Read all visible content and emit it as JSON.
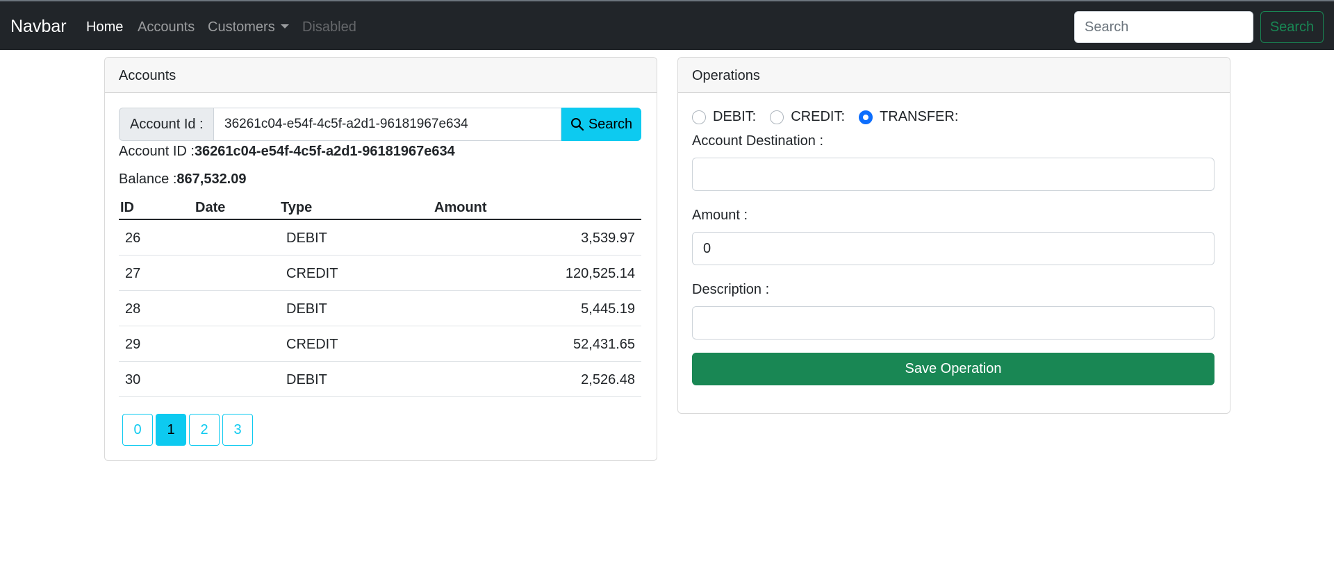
{
  "navbar": {
    "brand": "Navbar",
    "links": [
      {
        "label": "Home"
      },
      {
        "label": "Accounts"
      },
      {
        "label": "Customers"
      },
      {
        "label": "Disabled"
      }
    ],
    "search_placeholder": "Search",
    "search_button": "Search"
  },
  "accounts": {
    "title": "Accounts",
    "input_label": "Account Id :",
    "input_value": "36261c04-e54f-4c5f-a2d1-96181967e634",
    "search_button": "Search",
    "account_id_label": "Account ID :",
    "account_id_value": "36261c04-e54f-4c5f-a2d1-96181967e634",
    "balance_label": "Balance :",
    "balance_value": "867,532.09",
    "table": {
      "headers": [
        "ID",
        "Date",
        "Type",
        "Amount"
      ],
      "rows": [
        {
          "id": "26",
          "date": "",
          "type": "DEBIT",
          "amount": "3,539.97"
        },
        {
          "id": "27",
          "date": "",
          "type": "CREDIT",
          "amount": "120,525.14"
        },
        {
          "id": "28",
          "date": "",
          "type": "DEBIT",
          "amount": "5,445.19"
        },
        {
          "id": "29",
          "date": "",
          "type": "CREDIT",
          "amount": "52,431.65"
        },
        {
          "id": "30",
          "date": "",
          "type": "DEBIT",
          "amount": "2,526.48"
        }
      ]
    },
    "pages": [
      "0",
      "1",
      "2",
      "3"
    ],
    "current_page": "1"
  },
  "operations": {
    "title": "Operations",
    "radios": [
      {
        "label": "DEBIT:",
        "checked": false
      },
      {
        "label": "CREDIT:",
        "checked": false
      },
      {
        "label": "TRANSFER:",
        "checked": true
      }
    ],
    "destination_label": "Account Destination :",
    "destination_value": "",
    "amount_label": "Amount :",
    "amount_value": "0",
    "description_label": "Description :",
    "description_value": "",
    "save_button": "Save Operation"
  },
  "colors": {
    "navbar_bg": "#212529",
    "info": "#0dcaf0",
    "success": "#198754",
    "primary": "#0d6efd"
  }
}
